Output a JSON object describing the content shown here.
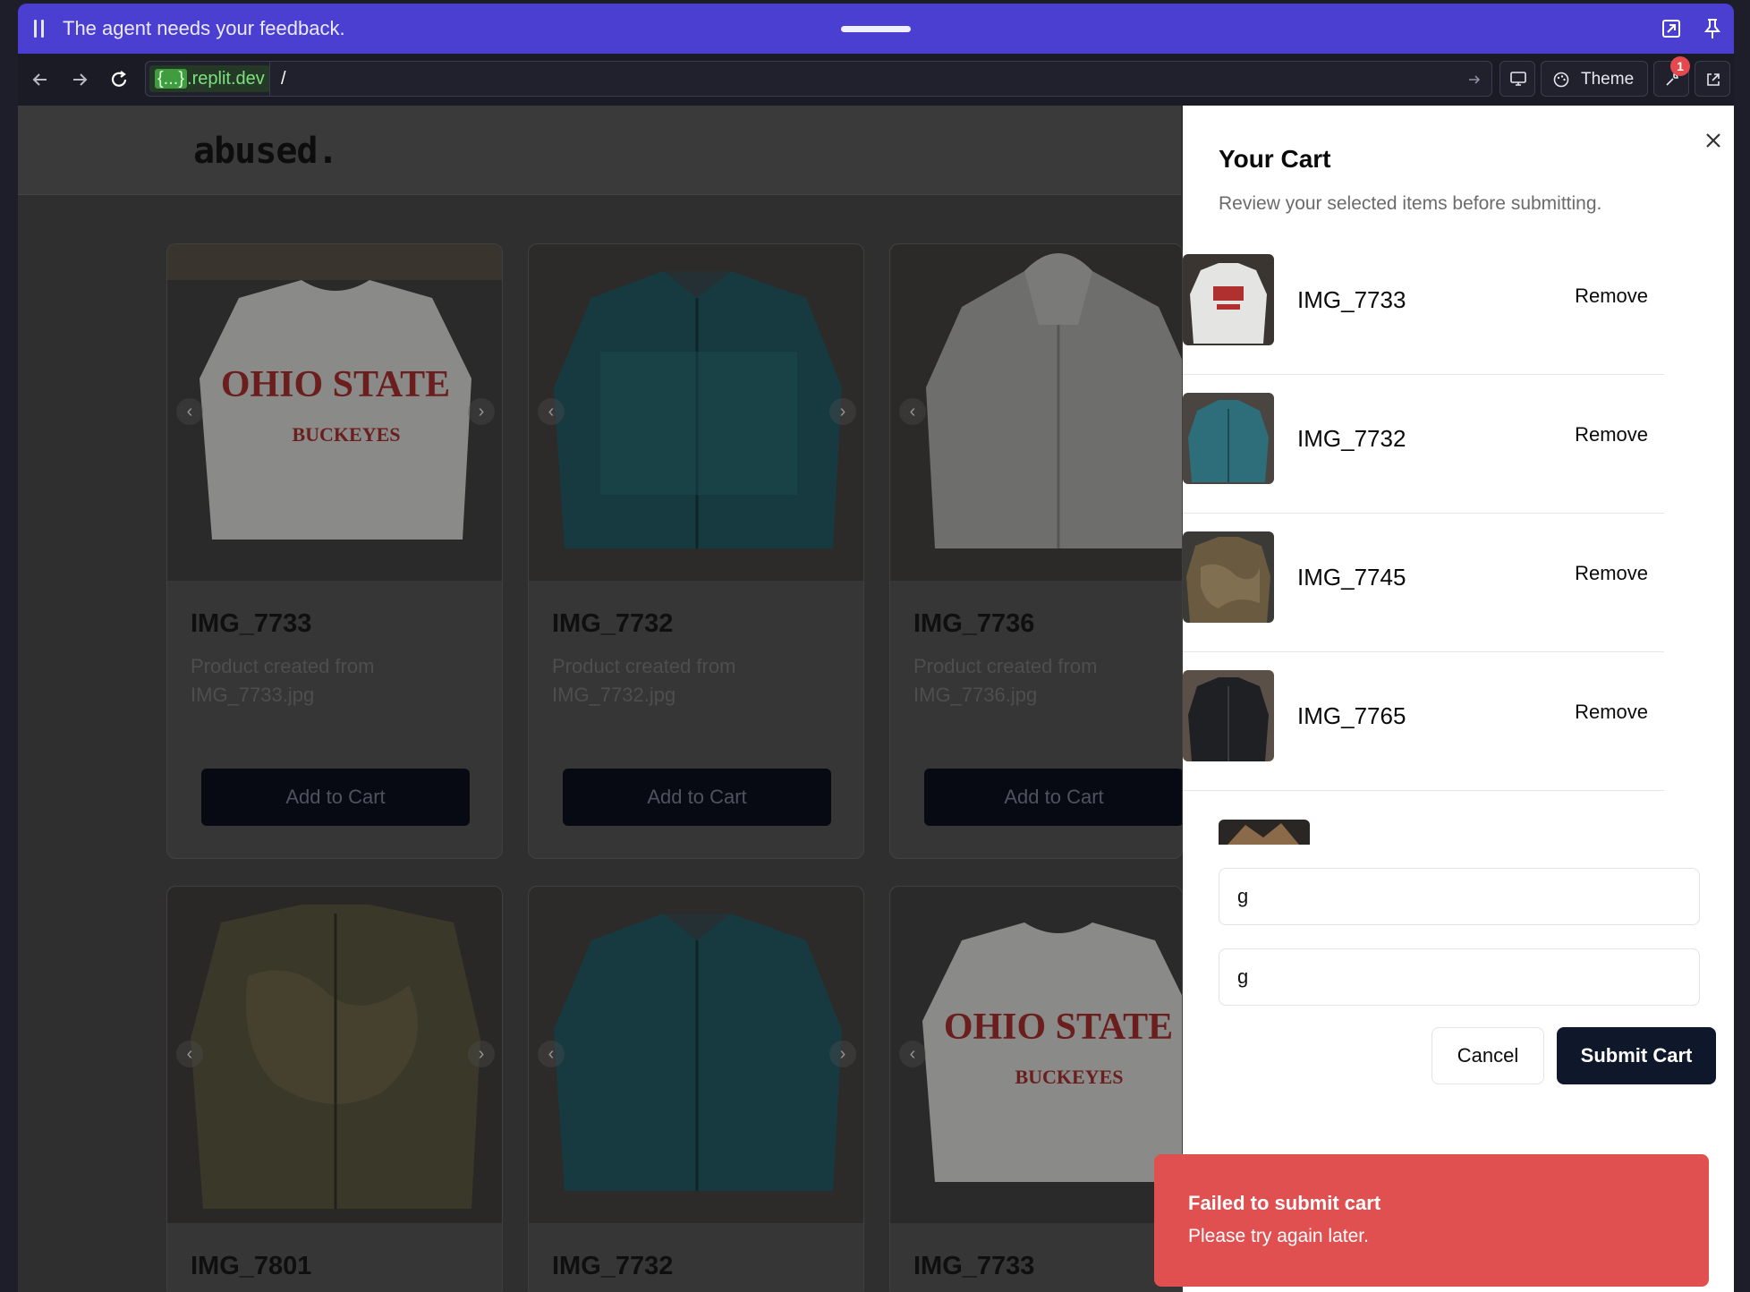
{
  "agent_bar": {
    "message": "The agent needs your feedback."
  },
  "browser": {
    "host_prefix": "{...}",
    "host_suffix": ".replit.dev",
    "path": "/",
    "theme_label": "Theme",
    "notification_count": "1"
  },
  "site": {
    "logo": "abused."
  },
  "products": [
    {
      "title": "IMG_7733",
      "desc": "Product created from IMG_7733.jpg",
      "button": "Add to Cart"
    },
    {
      "title": "IMG_7732",
      "desc": "Product created from IMG_7732.jpg",
      "button": "Add to Cart"
    },
    {
      "title": "IMG_7736",
      "desc": "Product created from IMG_7736.jpg",
      "button": "Add to Cart"
    },
    {
      "title": "IMG_7801"
    },
    {
      "title": "IMG_7732"
    },
    {
      "title": "IMG_7733"
    }
  ],
  "cart": {
    "title": "Your Cart",
    "subtitle": "Review your selected items before submitting.",
    "items": [
      {
        "name": "IMG_7733",
        "remove": "Remove"
      },
      {
        "name": "IMG_7732",
        "remove": "Remove"
      },
      {
        "name": "IMG_7745",
        "remove": "Remove"
      },
      {
        "name": "IMG_7765",
        "remove": "Remove"
      }
    ],
    "field1_value": "g",
    "field2_value": "g",
    "cancel_label": "Cancel",
    "submit_label": "Submit Cart"
  },
  "toast": {
    "title": "Failed to submit cart",
    "message": "Please try again later."
  }
}
